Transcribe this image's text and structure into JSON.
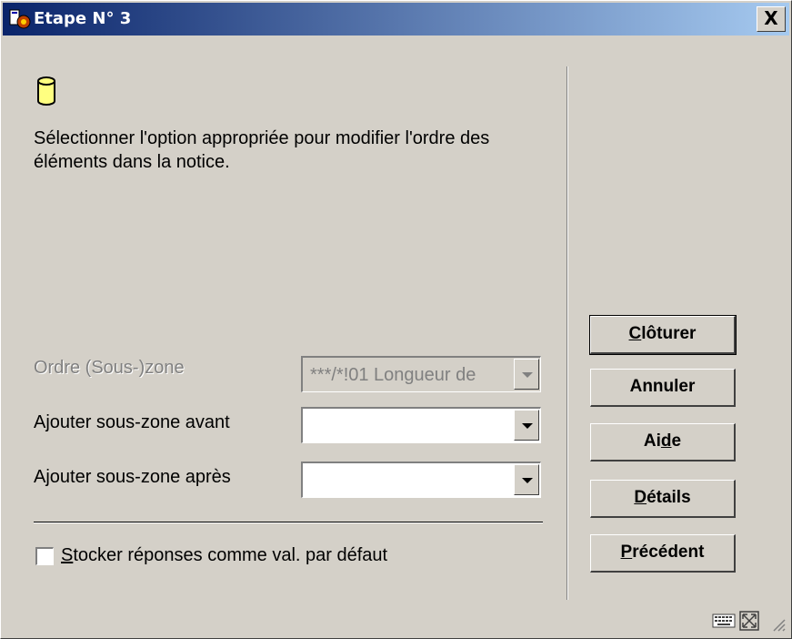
{
  "window": {
    "title": "Etape N° 3",
    "close_label": "X"
  },
  "instruction": "Sélectionner l'option appropriée pour modifier l'ordre des éléments dans la notice.",
  "form": {
    "order_label": "Ordre (Sous-)zone",
    "order_value": "***/*!01 Longueur de",
    "before_label": "Ajouter sous-zone avant",
    "before_value": "",
    "after_label": "Ajouter sous-zone après",
    "after_value": ""
  },
  "checkbox": {
    "mnemonic": "S",
    "rest": "tocker réponses comme val. par défaut",
    "checked": false
  },
  "buttons": {
    "close": {
      "mn": "C",
      "rest": "lôturer"
    },
    "cancel": "Annuler",
    "help": {
      "pre": "Ai",
      "mn": "d",
      "post": "e"
    },
    "details": {
      "mn": "D",
      "rest": "étails"
    },
    "previous": {
      "mn": "P",
      "rest": "récédent"
    }
  },
  "icons": [
    "app-icon",
    "database-icon",
    "keyboard-icon",
    "resize-icon"
  ]
}
